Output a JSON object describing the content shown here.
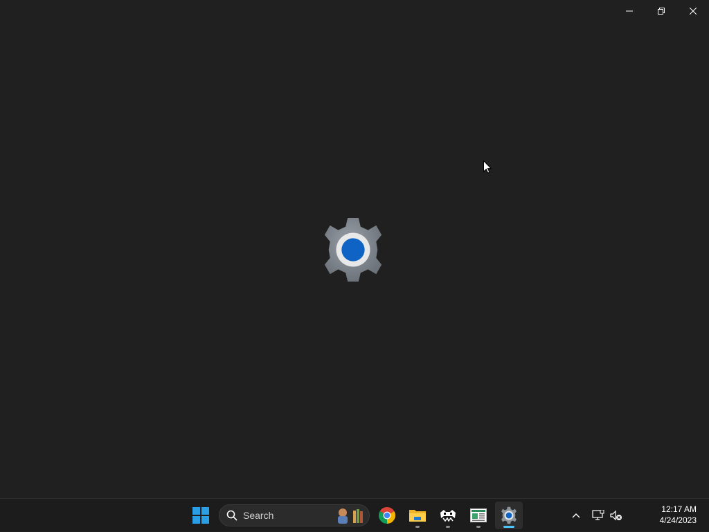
{
  "window": {
    "caption_buttons": [
      "minimize",
      "restore",
      "close"
    ]
  },
  "splash": {
    "icon": "settings-gear-icon",
    "accent": "#0f63c4"
  },
  "taskbar": {
    "start_icon": "windows-start-icon",
    "search": {
      "label": "Search"
    },
    "apps": [
      {
        "name": "chrome-icon",
        "running": false,
        "active": false
      },
      {
        "name": "file-explorer-icon",
        "running": true,
        "active": false
      },
      {
        "name": "game-app-icon",
        "running": true,
        "active": false
      },
      {
        "name": "news-app-icon",
        "running": true,
        "active": false
      },
      {
        "name": "settings-icon",
        "running": true,
        "active": true
      }
    ],
    "accent": "#4cc2ff"
  },
  "tray": {
    "icons": [
      "chevron-up-icon",
      "network-icon",
      "volume-muted-icon"
    ],
    "time": "12:17 AM",
    "date": "4/24/2023"
  }
}
